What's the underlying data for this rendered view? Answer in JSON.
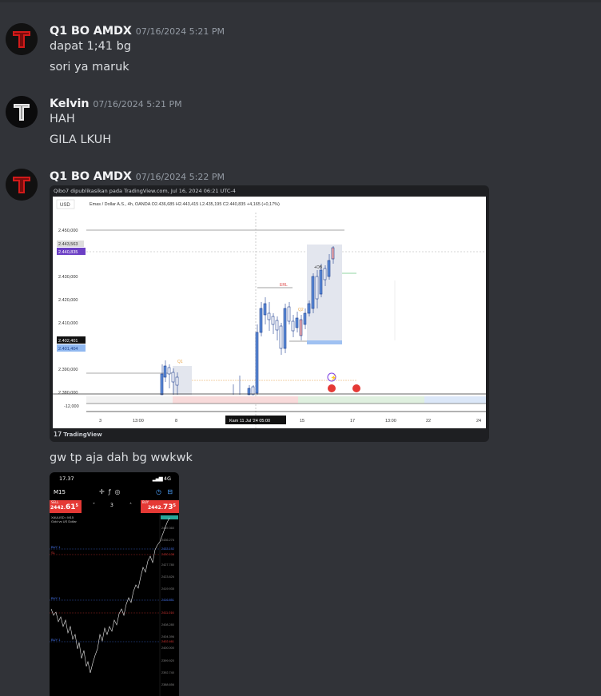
{
  "messages": [
    {
      "username": "Q1 BO AMDX",
      "timestamp": "07/16/2024 5:21 PM",
      "lines": [
        "dapat 1;41 bg",
        "sori ya maruk"
      ]
    },
    {
      "username": "Kelvin",
      "timestamp": "07/16/2024 5:21 PM",
      "lines": [
        "HAH",
        "GILA LKUH"
      ]
    },
    {
      "username": "Q1 BO AMDX",
      "timestamp": "07/16/2024 5:22 PM",
      "lines": [
        "gw tp aja dah bg wwkwk"
      ]
    }
  ],
  "chart_embed": {
    "published_by": "Qibo7 dipublikasikan pada TradingView.com, Jul 16, 2024 06:21 UTC-4",
    "currency": "USD",
    "symbol_info": "Emas / Dollar A.S., 4h, OANDA  O2.436,685  H2.443,415  L2.435,195  C2.440,835  +4,165 (+0,17%)",
    "footer": "TradingView",
    "price_labels": [
      "2.450,000",
      "2.443,563",
      "2.440,835",
      "2.430,000",
      "2.420,000",
      "2.410,000",
      "2.402,401",
      "2.401,404",
      "2.390,000",
      "2.380,000",
      "-12,000"
    ],
    "time_labels": [
      "3",
      "13:00",
      "8",
      "15",
      "17",
      "13:00",
      "22",
      "24"
    ],
    "crosshair_time": "Kam 11 Jul '24   05:00",
    "annotations": [
      "Q1",
      "ERL",
      "Q2",
      "+OB"
    ],
    "accent_purple": "#6c3fc5",
    "accent_blue": "#2962ff"
  },
  "phone": {
    "time": "17.37",
    "signal": "4G",
    "timeframe": "M15",
    "sell_label": "SELL",
    "sell_price_main": "2442.",
    "sell_price_big": "61",
    "sell_sup": "5",
    "buy_label": "BUY",
    "buy_price_main": "2442.",
    "buy_price_big": "73",
    "buy_sup": "5",
    "lot": "3",
    "symbol": "XAUUSD • M15",
    "symbol_desc": "Gold vs US Dollar",
    "price_ticks": [
      "2439.360",
      "2436.276",
      "2433.192",
      "2430.108",
      "2427.780",
      "2423.826",
      "2419.935",
      "2416.851",
      "2411.016",
      "2408.280",
      "2404.396",
      "2402.461",
      "2400.000",
      "2399.920",
      "2392.740",
      "2388.656"
    ],
    "line_labels": [
      "BUY 1",
      "SL",
      "BUY 1",
      "BUY 1"
    ]
  }
}
